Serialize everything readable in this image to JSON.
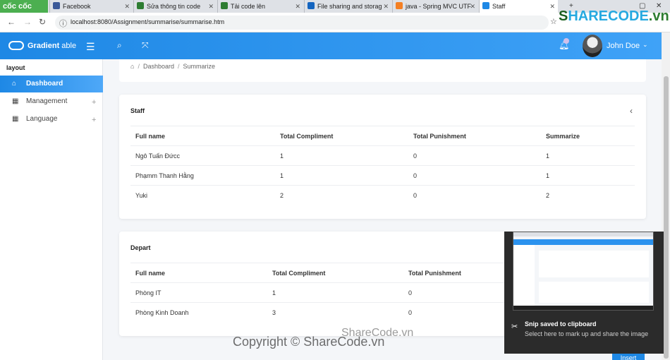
{
  "browser": {
    "brand": "cốc cốc",
    "tabs": [
      {
        "label": "Facebook",
        "color": "#3b5998"
      },
      {
        "label": "Sửa thông tin code",
        "color": "#2e7d32"
      },
      {
        "label": "Tải code lên",
        "color": "#2e7d32"
      },
      {
        "label": "File sharing and storag",
        "color": "#1565c0"
      },
      {
        "label": "java - Spring MVC UTF",
        "color": "#f48024"
      },
      {
        "label": "Staff",
        "color": "#1e88e5"
      }
    ],
    "url": "localhost:8080/Assignment/summarise/summarise.htm"
  },
  "header": {
    "logo_bold": "Gradient",
    "logo_light": " able",
    "user_name": "John Doe"
  },
  "sidebar": {
    "caption": "layout",
    "items": [
      {
        "label": "Dashboard",
        "icon": "home-icon"
      },
      {
        "label": "Management",
        "icon": "grid-icon"
      },
      {
        "label": "Language",
        "icon": "grid-icon"
      }
    ]
  },
  "breadcrumb": {
    "items": [
      "Dashboard",
      "Summarize"
    ]
  },
  "staff_card": {
    "title": "Staff",
    "headers": [
      "Full name",
      "Total Compliment",
      "Total Punishment",
      "Summarize"
    ],
    "rows": [
      [
        "Ngô Tuấn Đứcc",
        "1",
        "0",
        "1"
      ],
      [
        "Phạmm Thanh Hằng",
        "1",
        "0",
        "1"
      ],
      [
        "Yuki",
        "2",
        "0",
        "2"
      ]
    ]
  },
  "depart_card": {
    "title": "Depart",
    "headers": [
      "Full name",
      "Total Compliment",
      "Total Punishment"
    ],
    "rows": [
      [
        "Phòng IT",
        "1",
        "0"
      ],
      [
        "Phòng Kinh Doanh",
        "3",
        "0"
      ]
    ]
  },
  "snip": {
    "title": "Snip saved to clipboard",
    "subtitle": "Select here to mark up and share the image"
  },
  "insert_button": "Insert",
  "watermarks": {
    "top_lead": "S",
    "top_rest": "HARECODE",
    "top_suffix": ".vn",
    "middle": "ShareCode.vn",
    "bottom": "Copyright © ShareCode.vn"
  }
}
